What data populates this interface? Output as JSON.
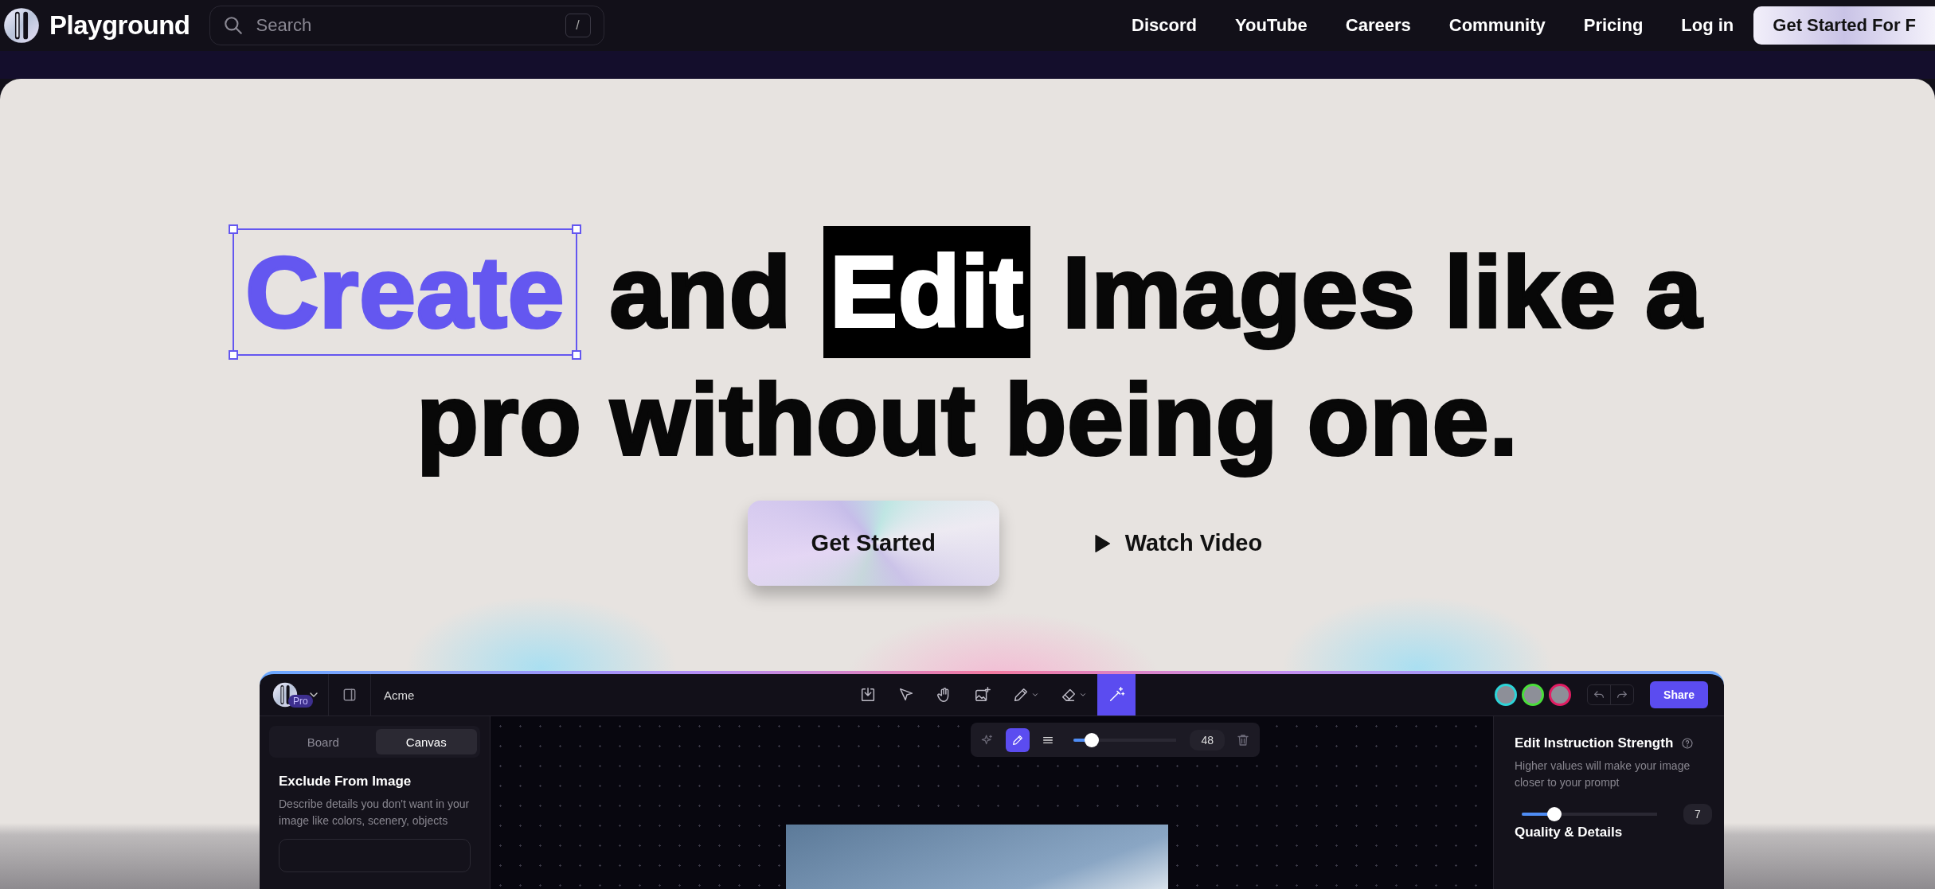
{
  "nav": {
    "brand": "Playground",
    "search": {
      "placeholder": "Search",
      "shortcut": "/"
    },
    "links": [
      "Discord",
      "YouTube",
      "Careers",
      "Community",
      "Pricing",
      "Log in"
    ],
    "cta": "Get Started For F"
  },
  "hero": {
    "lines": [
      {
        "segments": [
          {
            "text": "Create",
            "kind": "selected"
          },
          {
            "text": "and",
            "kind": "plain"
          },
          {
            "text": "Edit",
            "kind": "inverted"
          },
          {
            "text": "Images like a",
            "kind": "plain"
          }
        ]
      },
      {
        "segments": [
          {
            "text": "pro without being one.",
            "kind": "plain"
          }
        ]
      }
    ],
    "primary_button": "Get Started",
    "video_link": "Watch Video"
  },
  "app": {
    "plan_badge": "Pro",
    "project": "Acme",
    "tools": [
      {
        "kind": "export",
        "selected": false,
        "dropdown": false
      },
      {
        "kind": "pointer",
        "selected": false,
        "dropdown": false
      },
      {
        "kind": "hand",
        "selected": false,
        "dropdown": false
      },
      {
        "kind": "image",
        "selected": false,
        "dropdown": false
      },
      {
        "kind": "pencil",
        "selected": false,
        "dropdown": true
      },
      {
        "kind": "eraser",
        "selected": false,
        "dropdown": true
      },
      {
        "kind": "wand",
        "selected": true,
        "dropdown": false
      }
    ],
    "avatars": [
      {
        "color": "#2dd4d8"
      },
      {
        "color": "#4ade3a"
      },
      {
        "color": "#e11d63"
      }
    ],
    "share": "Share",
    "left_panel": {
      "tabs": [
        {
          "label": "Board",
          "selected": false
        },
        {
          "label": "Canvas",
          "selected": true
        }
      ],
      "title": "Exclude From Image",
      "description": "Describe details you don't want in your image like colors, scenery, objects"
    },
    "canvas_toolbar": {
      "tools": [
        {
          "kind": "sparkle",
          "selected": false
        },
        {
          "kind": "pencil",
          "selected": true
        }
      ],
      "brush_size": {
        "level": 0.18,
        "value": "48"
      }
    },
    "right_panel": {
      "sections": [
        {
          "title": "Edit Instruction Strength",
          "description": "Higher values will make your image closer to your prompt",
          "level": 0.24,
          "value": "7"
        },
        {
          "title": "Quality & Details"
        }
      ]
    }
  }
}
